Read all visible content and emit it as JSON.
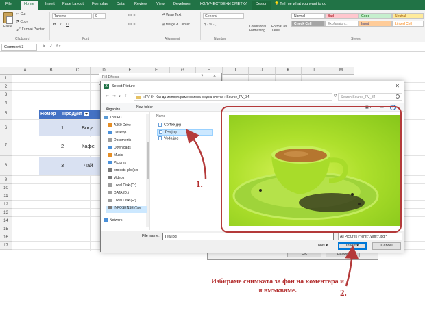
{
  "colors": {
    "excel_green": "#217346",
    "table_header": "#4472c4",
    "annotation_red": "#b32e2e"
  },
  "menu": {
    "tabs": [
      "File",
      "Home",
      "Insert",
      "Page Layout",
      "Formulas",
      "Data",
      "Review",
      "View",
      "Developer",
      "КОЛИЧЕСТВЕНИ СМЕТКИ",
      "Design"
    ],
    "tell_me": "Tell me what you want to do"
  },
  "ribbon": {
    "cut": "Cut",
    "copy": "Copy",
    "paste": "Paste",
    "format_painter": "Format Painter",
    "clipboard": "Clipboard",
    "font_name": "Tahoma",
    "font_size": "9",
    "font": "Font",
    "wrap_text": "Wrap Text",
    "merge_center": "Merge & Center",
    "alignment": "Alignment",
    "number_format": "General",
    "number": "Number",
    "conditional_formatting": "Conditional Formatting",
    "format_as_table": "Format as Table",
    "styles": "Styles",
    "style_cells": [
      "Normal",
      "Bad",
      "Good",
      "Neutral",
      "Check Cell",
      "Explanatory...",
      "Input",
      "Linked Cell"
    ]
  },
  "formula_bar": {
    "name_box": "Comment 3",
    "fx": "fx"
  },
  "grid": {
    "columns": [
      "A",
      "B",
      "C",
      "D",
      "E",
      "F",
      "G",
      "H",
      "I",
      "J",
      "K",
      "L",
      "M"
    ],
    "rows": [
      "1",
      "2",
      "3",
      "4",
      "5",
      "6",
      "7",
      "8",
      "9",
      "10",
      "11",
      "12",
      "13",
      "14",
      "15",
      "16",
      "17"
    ]
  },
  "table": {
    "headers": [
      "Номер",
      "Продукт"
    ],
    "rows": [
      {
        "num": "1",
        "product": "Вода"
      },
      {
        "num": "2",
        "product": "Кафе"
      },
      {
        "num": "3",
        "product": "Чай"
      }
    ]
  },
  "fill_effects": {
    "title": "Fill Effects",
    "help": "?",
    "close": "×",
    "ok": "OK",
    "cancel": "Cancel"
  },
  "select_picture": {
    "title": "Select Picture",
    "path": "«  FV-34-Как да импортираме снимка в една клетка  ›  Source_FV_34",
    "search_placeholder": "Search Source_FV_34",
    "organize": "Organize",
    "new_folder": "New folder",
    "nav_items": [
      "This PC",
      "A360 Drive",
      "Desktop",
      "Documents",
      "Downloads",
      "Music",
      "Pictures",
      "projects-plb (ser",
      "Videos",
      "Local Disk (C:)",
      "DATA (D:)",
      "Local Disk (E:)",
      "INFOSENSE (\\\\se",
      "Network"
    ],
    "column_name": "Name",
    "files": [
      "Coffee.jpg",
      "Tea.jpg",
      "Voda.jpg"
    ],
    "file_name_label": "File name:",
    "file_name_value": "Tea.jpg",
    "file_type": "All Pictures (*.emf;*.wmf;*.jpg;*",
    "tools": "Tools",
    "insert": "Insert",
    "cancel": "Cancel"
  },
  "annotations": {
    "step1": "1.",
    "step2": "2.",
    "description": "Избираме снимката за фон на коментара и я вмъкваме."
  }
}
